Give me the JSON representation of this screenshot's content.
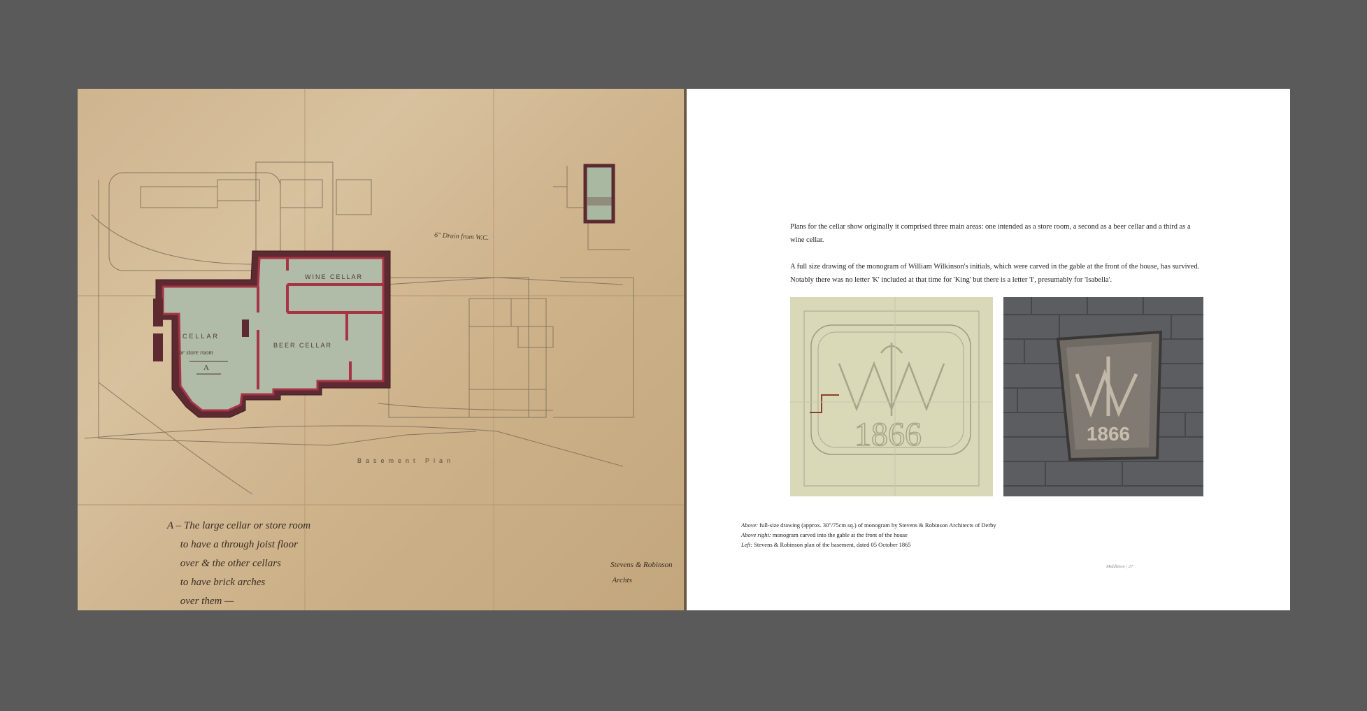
{
  "plan": {
    "title": "Basement Plan",
    "rooms": {
      "wine_cellar": "WINE CELLAR",
      "beer_cellar": "BEER CELLAR",
      "cellar": "CELLAR",
      "store": "or store room",
      "marker": "A"
    },
    "drain_note": "6\" Drain from W.C.",
    "note": "A – The large cellar or store room\n     to have a through joist floor\n     over & the other cellars\n     to have brick arches\n     over them —",
    "signature": "Stevens & Robinson\n Archts"
  },
  "text": {
    "para1": "Plans for the cellar show originally it comprised three main areas: one intended as a store room, a second as a beer cellar and a third as a wine cellar.",
    "para2": "A full size drawing of the monogram of William Wilkinson's initials, which were carved in the gable at the front of the house, has survived. Notably there was no letter 'K' included at that time for 'King' but there is a letter 'I', presumably for 'Isabella'."
  },
  "photos": {
    "drawing_year": "1866",
    "carving_year": "1866"
  },
  "captions": [
    {
      "label": "Above:",
      "text": " full-size drawing (approx. 30\"/75cm sq.) of monogram by Stevens & Robinson Architects of Derby"
    },
    {
      "label": "Above right:",
      "text": " monogram carved into the gable at the front of the house"
    },
    {
      "label": "Left:",
      "text": " Stevens & Robinson plan of the basement, dated 05 October 1865"
    }
  ],
  "folio": "Middleton | 27",
  "colors": {
    "background": "#5a5a5a",
    "paper": "#d2b993",
    "wall": "#9a3040",
    "room_fill": "#a9b8a0",
    "ink": "#5a4a3a"
  }
}
